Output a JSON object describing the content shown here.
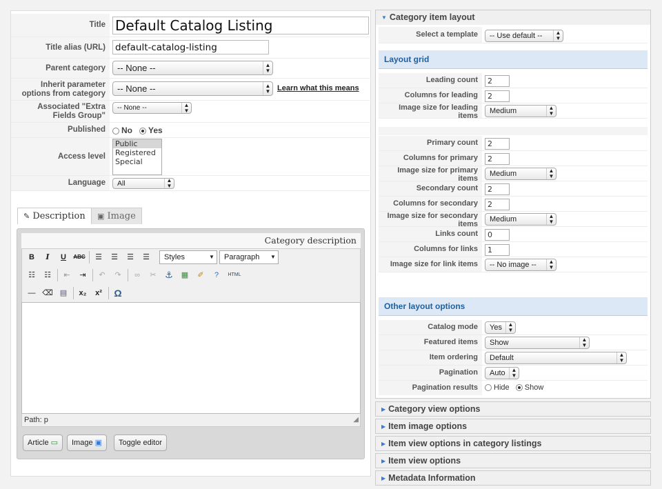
{
  "form": {
    "title_label": "Title",
    "title_value": "Default Catalog Listing",
    "alias_label": "Title alias (URL)",
    "alias_value": "default-catalog-listing",
    "parent_label": "Parent category",
    "parent_value": "-- None --",
    "inherit_label_1": "Inherit parameter",
    "inherit_label_2": "options from category",
    "inherit_value": "-- None --",
    "inherit_link": "Learn what this means",
    "extra_label_1": "Associated \"Extra",
    "extra_label_2": "Fields Group\"",
    "extra_value": "-- None --",
    "published_label": "Published",
    "published_no": "No",
    "published_yes": "Yes",
    "published_selected": "Yes",
    "access_label": "Access level",
    "access_options": [
      "Public",
      "Registered",
      "Special"
    ],
    "access_selected": "Public",
    "language_label": "Language",
    "language_value": "All"
  },
  "tabs": {
    "description": "Description",
    "image": "Image"
  },
  "editor": {
    "header": "Category description",
    "styles_value": "Styles",
    "format_value": "Paragraph",
    "path": "Path: p",
    "html_label": "HTML",
    "buttons": {
      "article": "Article",
      "image": "Image",
      "toggle": "Toggle editor"
    }
  },
  "right": {
    "category_item_layout": "Category item layout",
    "select_template_label": "Select a template",
    "select_template_value": "-- Use default --",
    "layout_grid_title": "Layout grid",
    "rows_grid": [
      {
        "label_1": "Leading count",
        "label_2": "",
        "value": "2",
        "kind": "num"
      },
      {
        "label_1": "Columns for leading",
        "label_2": "",
        "value": "2",
        "kind": "num"
      },
      {
        "label_1": "Image size for leading",
        "label_2": "items",
        "value": "Medium",
        "kind": "sel"
      }
    ],
    "rows_grid2": [
      {
        "label_1": "Primary count",
        "label_2": "",
        "value": "2",
        "kind": "num"
      },
      {
        "label_1": "Columns for primary",
        "label_2": "",
        "value": "2",
        "kind": "num"
      },
      {
        "label_1": "Image size for primary",
        "label_2": "items",
        "value": "Medium",
        "kind": "sel"
      },
      {
        "label_1": "Secondary count",
        "label_2": "",
        "value": "2",
        "kind": "num"
      },
      {
        "label_1": "Columns for secondary",
        "label_2": "",
        "value": "2",
        "kind": "num"
      },
      {
        "label_1": "Image size for secondary",
        "label_2": "items",
        "value": "Medium",
        "kind": "sel"
      },
      {
        "label_1": "Links count",
        "label_2": "",
        "value": "0",
        "kind": "num"
      },
      {
        "label_1": "Columns for links",
        "label_2": "",
        "value": "1",
        "kind": "num"
      },
      {
        "label_1": "Image size for link items",
        "label_2": "",
        "value": "-- No image --",
        "kind": "sel"
      }
    ],
    "other_title": "Other layout options",
    "catalog_mode_label": "Catalog mode",
    "catalog_mode_value": "Yes",
    "featured_label": "Featured items",
    "featured_value": "Show",
    "ordering_label": "Item ordering",
    "ordering_value": "Default",
    "pagination_label": "Pagination",
    "pagination_value": "Auto",
    "pagination_results_label": "Pagination results",
    "pagination_hide": "Hide",
    "pagination_show": "Show",
    "pagination_results_selected": "Show",
    "collapsed_panels": [
      "Category view options",
      "Item image options",
      "Item view options in category listings",
      "Item view options",
      "Metadata Information"
    ]
  }
}
